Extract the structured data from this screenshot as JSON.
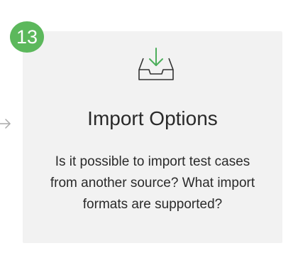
{
  "step": {
    "number": "13",
    "badge_color": "#5cb85c"
  },
  "card": {
    "icon": "inbox-download-icon",
    "icon_color": "#4cae5b",
    "title": "Import Options",
    "description": "Is it possible to import test cases from another source? What import formats are supported?",
    "background": "#f2f2f2"
  },
  "connector": {
    "icon": "arrow-right-icon",
    "color": "#aaaaaa"
  }
}
